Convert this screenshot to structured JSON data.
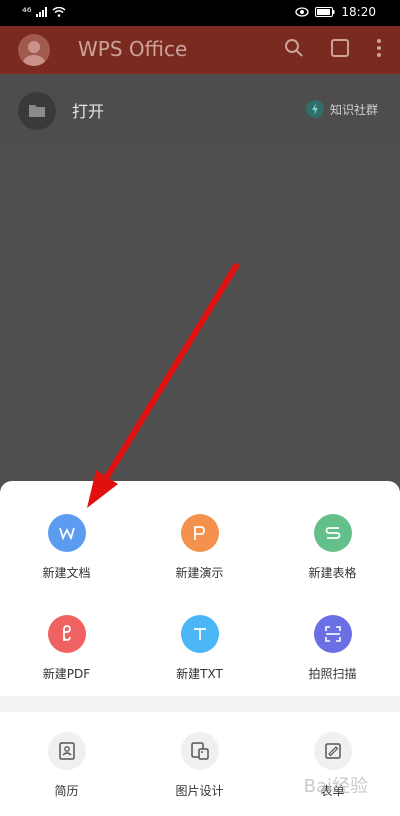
{
  "status_bar": {
    "carrier": "⁴⁶",
    "time": "18:20"
  },
  "app_bar": {
    "title": "WPS Office"
  },
  "open_row": {
    "label": "打开",
    "community": "知识社群"
  },
  "create_items": [
    {
      "label": "新建文档",
      "glyph": "W",
      "color": "#5b9bf0"
    },
    {
      "label": "新建演示",
      "glyph": "P",
      "color": "#f4924d"
    },
    {
      "label": "新建表格",
      "glyph": "S",
      "color": "#64c08a"
    },
    {
      "label": "新建PDF",
      "glyph": "P",
      "color": "#f06262"
    },
    {
      "label": "新建TXT",
      "glyph": "T",
      "color": "#4ab6f5"
    },
    {
      "label": "拍照扫描",
      "glyph": "scan",
      "color": "#6b6fe6"
    }
  ],
  "tool_items": [
    {
      "label": "简历"
    },
    {
      "label": "图片设计"
    },
    {
      "label": "表单"
    }
  ],
  "watermark": "Bai经验"
}
